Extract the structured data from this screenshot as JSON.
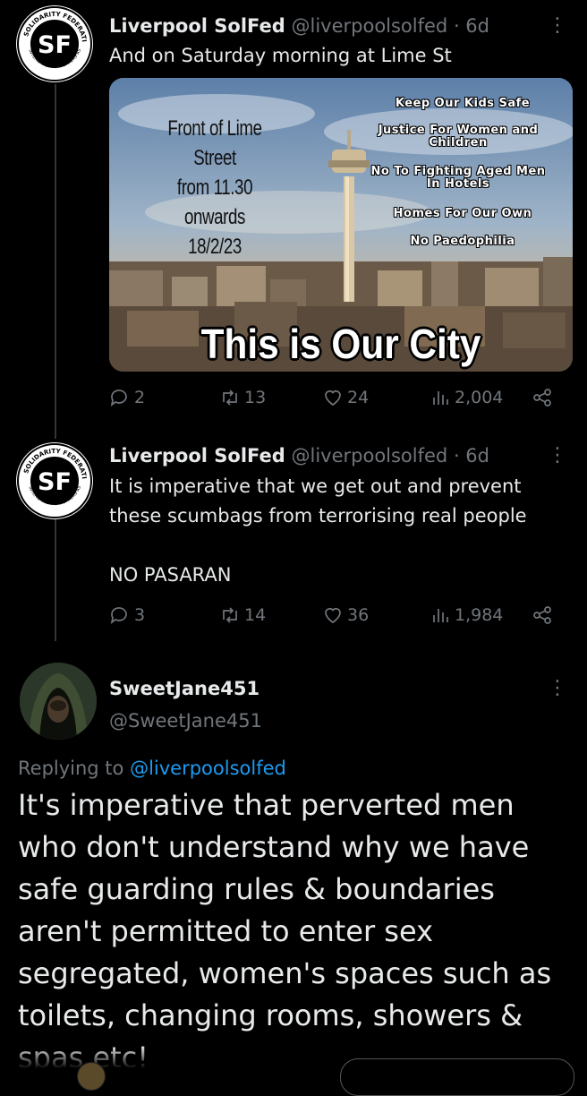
{
  "tweets": [
    {
      "name": "Liverpool SolFed",
      "handle": "@liverpoolsolfed",
      "time": "· 6d",
      "text": "And on Saturday morning at Lime St",
      "media": {
        "left_lines": [
          "Front of Lime Street",
          "from 11.30 onwards",
          "18/2/23"
        ],
        "right_lines": [
          "Keep Our Kids Safe",
          "Justice For Women and Children",
          "No To Fighting Aged Men In Hotels",
          "Homes For Our Own",
          "No Paedophilia"
        ],
        "caption": "This is Our City"
      },
      "stats": {
        "replies": "2",
        "retweets": "13",
        "likes": "24",
        "views": "2,004"
      }
    },
    {
      "name": "Liverpool SolFed",
      "handle": "@liverpoolsolfed",
      "time": "· 6d",
      "text": "It is imperative that we get out and prevent\nthese scumbags from terrorising  real people\n\nNO PASARAN",
      "stats": {
        "replies": "3",
        "retweets": "14",
        "likes": "36",
        "views": "1,984"
      }
    }
  ],
  "reply": {
    "name": "SweetJane451",
    "handle": "@SweetJane451",
    "replying_prefix": "Replying to ",
    "replying_handle": "@liverpoolsolfed",
    "text": "It's imperative that perverted men who don't understand why we have safe guarding rules & boundaries aren't permitted to enter sex segregated, women's spaces such as toilets, changing rooms, showers & spas etc!"
  },
  "avatar_logo": {
    "initials": "SF",
    "ring_top": "SOLIDARITY FEDERATION",
    "ring_bottom": "INTERNATIONAL WORKERS ASSOCIATION"
  },
  "more_glyph": "⋮",
  "colors": {
    "background": "#000000",
    "text": "#e7e9ea",
    "muted": "#71767b",
    "link": "#1d9bf0"
  },
  "icons": [
    "reply-icon",
    "retweet-icon",
    "like-icon",
    "views-icon",
    "share-icon",
    "more-icon"
  ]
}
